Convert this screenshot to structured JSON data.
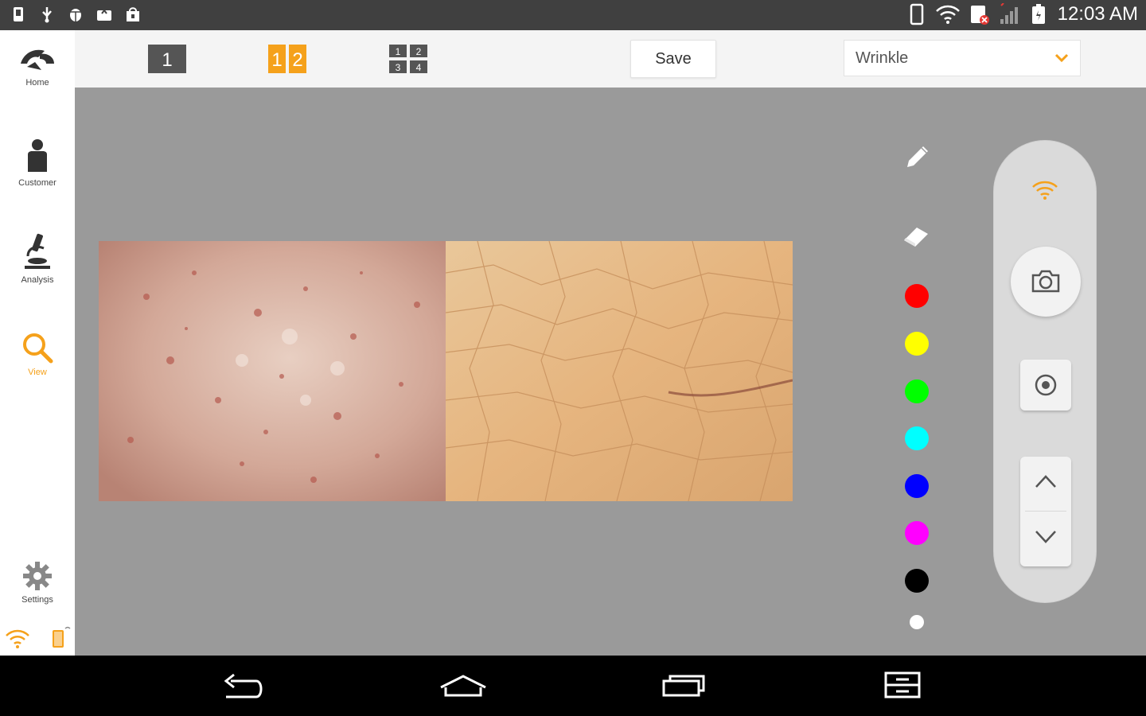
{
  "status_bar": {
    "time": "12:03 AM",
    "left_icons": [
      "phone-storage-icon",
      "usb-icon",
      "android-debug-icon",
      "photo-upload-icon",
      "shopping-bag-icon"
    ],
    "right_icons": [
      "phone-icon",
      "wifi-icon",
      "sd-card-error-icon",
      "signal-icon",
      "battery-icon"
    ]
  },
  "sidebar": {
    "items": [
      {
        "label": "Home",
        "icon": "logo-icon"
      },
      {
        "label": "Customer",
        "icon": "person-icon"
      },
      {
        "label": "Analysis",
        "icon": "microscope-icon"
      },
      {
        "label": "View",
        "icon": "search-icon",
        "active": true
      },
      {
        "label": "Settings",
        "icon": "gear-icon"
      }
    ],
    "bottom_icons": [
      "wifi-icon",
      "device-battery-icon"
    ]
  },
  "toolbar": {
    "layouts": [
      {
        "label": "1",
        "name": "single"
      },
      {
        "label": "12",
        "name": "split-two",
        "active": true
      },
      {
        "label": "1234",
        "name": "quad"
      }
    ],
    "save_label": "Save",
    "selected_mode": "Wrinkle"
  },
  "tools": {
    "items": [
      "pencil-icon",
      "eraser-icon"
    ],
    "colors": [
      "#ff0000",
      "#ffff00",
      "#00ff00",
      "#00ffff",
      "#0000ff",
      "#ff00ff",
      "#000000",
      "#ffffff"
    ]
  },
  "control_panel": {
    "icons": [
      "wifi-icon",
      "camera-icon",
      "record-icon",
      "chevron-up-icon",
      "chevron-down-icon"
    ]
  },
  "nav_bar": {
    "buttons": [
      "back-icon",
      "home-icon",
      "recents-icon",
      "menu-icon"
    ]
  },
  "colors": {
    "accent": "#f5a11b",
    "canvas_background": "#9a9a9a",
    "status_bar": "#404040"
  }
}
